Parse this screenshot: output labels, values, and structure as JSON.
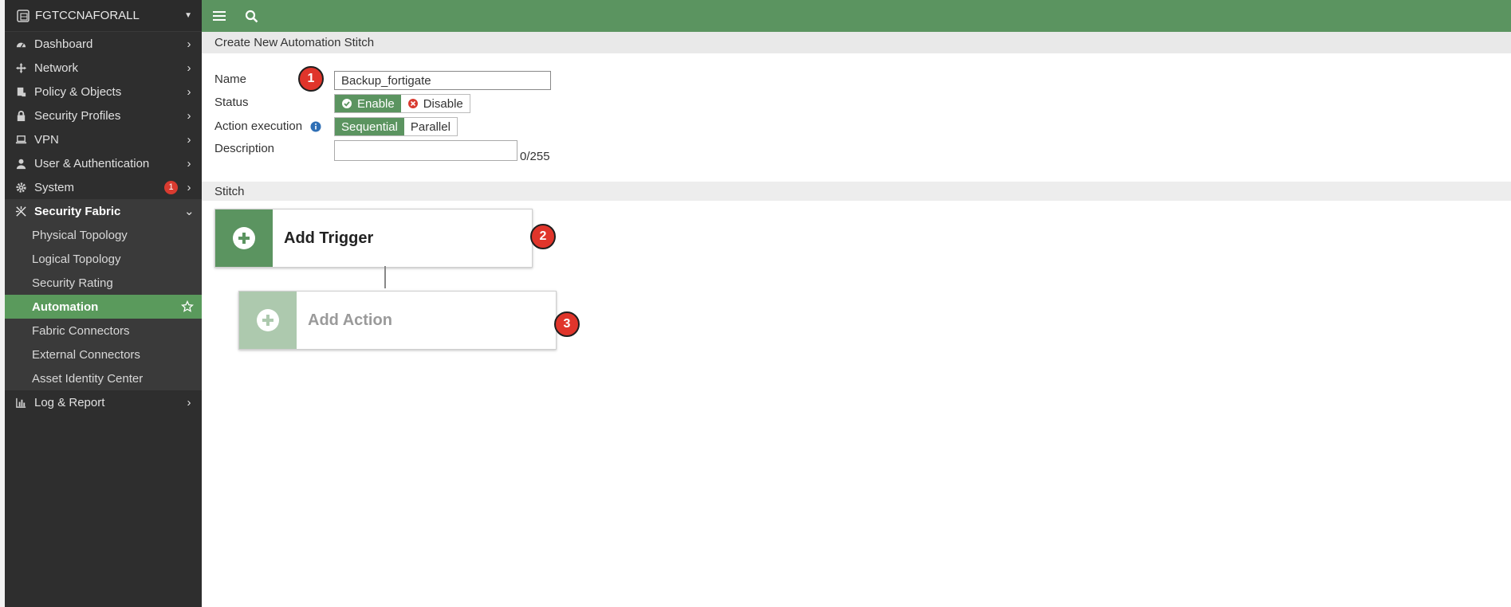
{
  "sidebar": {
    "device_name": "FGTCCNAFORALL",
    "items": [
      {
        "label": "Dashboard",
        "icon": "dashboard-icon"
      },
      {
        "label": "Network",
        "icon": "network-icon"
      },
      {
        "label": "Policy & Objects",
        "icon": "policy-icon"
      },
      {
        "label": "Security Profiles",
        "icon": "lock-icon"
      },
      {
        "label": "VPN",
        "icon": "laptop-icon"
      },
      {
        "label": "User & Authentication",
        "icon": "user-icon"
      },
      {
        "label": "System",
        "icon": "gear-icon",
        "badge": "1"
      },
      {
        "label": "Security Fabric",
        "icon": "fabric-icon"
      },
      {
        "label": "Log & Report",
        "icon": "chart-icon"
      }
    ],
    "fabric_sub": [
      "Physical Topology",
      "Logical Topology",
      "Security Rating",
      "Automation",
      "Fabric Connectors",
      "External Connectors",
      "Asset Identity Center"
    ]
  },
  "page": {
    "title": "Create New Automation Stitch",
    "name_label": "Name",
    "name_value": "Backup_fortigate",
    "status_label": "Status",
    "status_enable": "Enable",
    "status_disable": "Disable",
    "action_label": "Action execution",
    "action_sequential": "Sequential",
    "action_parallel": "Parallel",
    "description_label": "Description",
    "description_counter": "0/255",
    "stitch_label": "Stitch",
    "add_trigger": "Add Trigger",
    "add_action": "Add Action"
  },
  "markers": [
    "1",
    "2",
    "3"
  ],
  "colors": {
    "brand_green": "#5b9460",
    "sidebar_bg": "#2e2e2e",
    "marker_red": "#e0352b",
    "disable_red": "#d93b30"
  }
}
